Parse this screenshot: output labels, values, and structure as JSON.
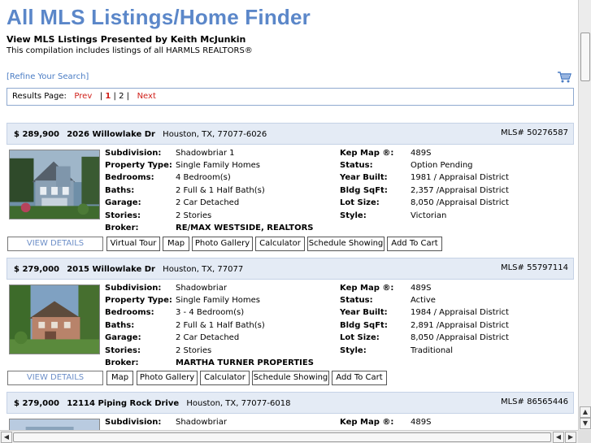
{
  "header": {
    "title": "All MLS Listings/Home Finder",
    "subtitle": "View MLS Listings Presented by Keith McJunkin",
    "compilation": "This compilation includes listings of all HARMLS REALTORS®",
    "refine": "[Refine Your Search]",
    "cart_icon": "shopping-cart-icon"
  },
  "results": {
    "label": "Results Page:",
    "prev": "Prev",
    "sep1": "|",
    "page1": "1",
    "sep2": "|",
    "page2": "2",
    "sep3": "|",
    "next": "Next"
  },
  "listings": [
    {
      "price": "$ 289,900",
      "address": "2026 Willowlake Dr",
      "city": "Houston, TX, 77077-6026",
      "mls": "MLS# 50276587",
      "subdivision": "Shadowbriar 1",
      "property_type": "Single Family Homes",
      "bedrooms": "4 Bedroom(s)",
      "baths": "2 Full & 1 Half Bath(s)",
      "garage": "2 Car Detached",
      "stories": "2 Stories",
      "broker": "RE/MAX WESTSIDE, REALTORS",
      "kep_map": "489S",
      "status": "Option Pending",
      "year_built": "1981 / Appraisal District",
      "bldg_sqft": "2,357 /Appraisal District",
      "lot_size": "8,050 /Appraisal District",
      "style": "Victorian",
      "buttons": [
        "Virtual Tour",
        "Map",
        "Photo Gallery",
        "Calculator",
        "Schedule Showing",
        "Add To Cart"
      ]
    },
    {
      "price": "$ 279,000",
      "address": "2015 Willowlake Dr",
      "city": "Houston, TX, 77077",
      "mls": "MLS# 55797114",
      "subdivision": "Shadowbriar",
      "property_type": "Single Family Homes",
      "bedrooms": "3 - 4 Bedroom(s)",
      "baths": "2 Full & 1 Half Bath(s)",
      "garage": "2 Car Detached",
      "stories": "2 Stories",
      "broker": "MARTHA TURNER PROPERTIES",
      "kep_map": "489S",
      "status": "Active",
      "year_built": "1984 / Appraisal District",
      "bldg_sqft": "2,891 /Appraisal District",
      "lot_size": "8,050 /Appraisal District",
      "style": "Traditional",
      "buttons": [
        "Map",
        "Photo Gallery",
        "Calculator",
        "Schedule Showing",
        "Add To Cart"
      ]
    },
    {
      "price": "$ 279,000",
      "address": "12114 Piping Rock Drive",
      "city": "Houston, TX, 77077-6018",
      "mls": "MLS# 86565446",
      "subdivision": "Shadowbriar",
      "kep_map": "489S"
    }
  ],
  "labels": {
    "subdivision": "Subdivision:",
    "property_type": "Property Type:",
    "bedrooms": "Bedrooms:",
    "baths": "Baths:",
    "garage": "Garage:",
    "stories": "Stories:",
    "broker": "Broker:",
    "kep_map": "Kep Map ®:",
    "status": "Status:",
    "year_built": "Year Built:",
    "bldg_sqft": "Bldg SqFt:",
    "lot_size": "Lot Size:",
    "style": "Style:",
    "view_details": "VIEW DETAILS"
  },
  "colors": {
    "title": "#5b87c9",
    "link_red": "#d0201a",
    "header_bg": "#e4ebf5"
  }
}
